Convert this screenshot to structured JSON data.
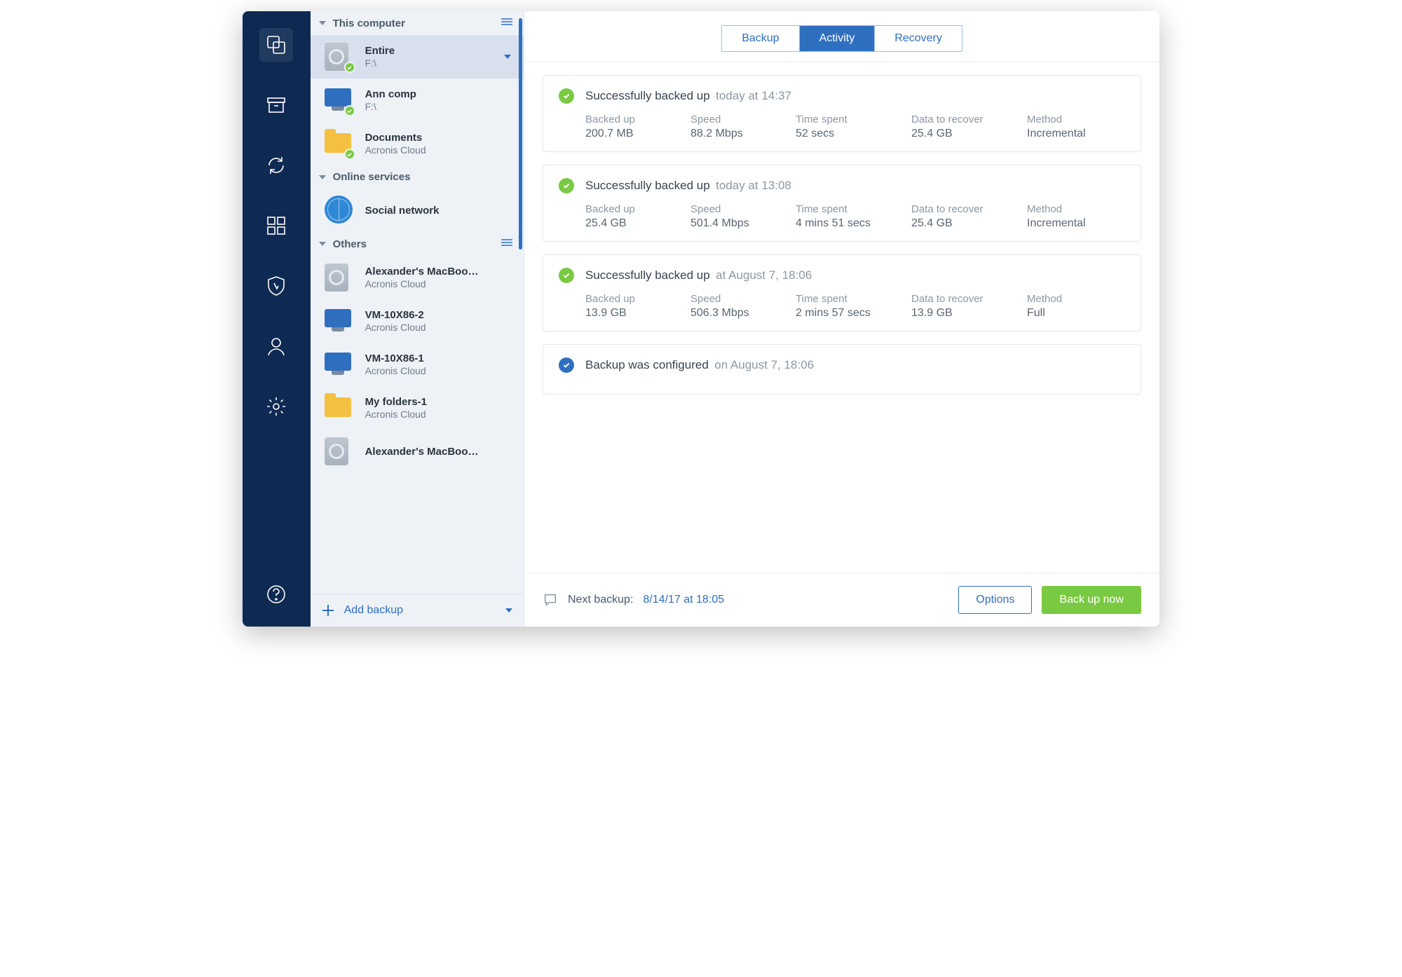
{
  "sidebar": {
    "sections": [
      {
        "title": "This computer",
        "has_menu": true,
        "items": [
          {
            "name": "Entire",
            "sub": "F:\\",
            "icon": "drive",
            "status": "ok",
            "active": true,
            "chevron": true
          },
          {
            "name": "Ann comp",
            "sub": "F:\\",
            "icon": "monitor",
            "status": "ok"
          },
          {
            "name": "Documents",
            "sub": "Acronis Cloud",
            "icon": "folder",
            "status": "ok"
          }
        ]
      },
      {
        "title": "Online services",
        "has_menu": false,
        "items": [
          {
            "name": "Social network",
            "sub": "",
            "icon": "globe"
          }
        ]
      },
      {
        "title": "Others",
        "has_menu": true,
        "items": [
          {
            "name": "Alexander's MacBoo…",
            "sub": "Acronis Cloud",
            "icon": "drive"
          },
          {
            "name": "VM-10X86-2",
            "sub": "Acronis Cloud",
            "icon": "monitor"
          },
          {
            "name": "VM-10X86-1",
            "sub": "Acronis Cloud",
            "icon": "monitor"
          },
          {
            "name": "My folders-1",
            "sub": "Acronis Cloud",
            "icon": "folder"
          },
          {
            "name": "Alexander's MacBoo…",
            "sub": "",
            "icon": "drive"
          }
        ]
      }
    ],
    "add_backup": "Add backup"
  },
  "tabs": {
    "backup": "Backup",
    "activity": "Activity",
    "recovery": "Recovery",
    "active": "activity"
  },
  "activity": [
    {
      "status": "green",
      "title": "Successfully backed up",
      "when": "today at 14:37",
      "metrics": {
        "Backed up": "200.7 MB",
        "Speed": "88.2 Mbps",
        "Time spent": "52 secs",
        "Data to recover": "25.4 GB",
        "Method": "Incremental"
      }
    },
    {
      "status": "green",
      "title": "Successfully backed up",
      "when": "today at 13:08",
      "metrics": {
        "Backed up": "25.4 GB",
        "Speed": "501.4 Mbps",
        "Time spent": "4 mins 51 secs",
        "Data to recover": "25.4 GB",
        "Method": "Incremental"
      }
    },
    {
      "status": "green",
      "title": "Successfully backed up",
      "when": "at August 7, 18:06",
      "metrics": {
        "Backed up": "13.9 GB",
        "Speed": "506.3 Mbps",
        "Time spent": "2 mins 57 secs",
        "Data to recover": "13.9 GB",
        "Method": "Full"
      }
    },
    {
      "status": "blue",
      "title": "Backup was configured",
      "when": "on August 7, 18:06"
    }
  ],
  "footer": {
    "next_backup_label": "Next backup:",
    "next_backup_value": "8/14/17 at 18:05",
    "options": "Options",
    "backup_now": "Back up now"
  }
}
